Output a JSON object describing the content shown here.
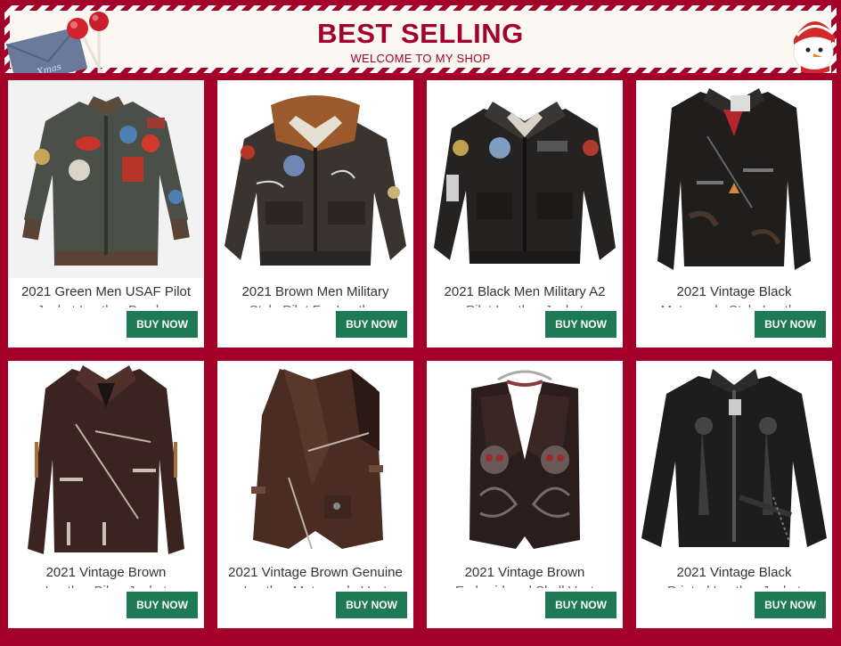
{
  "banner": {
    "title": "BEST SELLING",
    "subtitle": "WELCOME TO MY SHOP",
    "envelope_text": "Xmas",
    "accent_color": "#a3002a",
    "background_color": "#fbf7f1"
  },
  "button_color": "#1d7a55",
  "products": [
    {
      "title": "2021 Green Men USAF Pilot",
      "title_line2": "Jacket Leather Bomber",
      "button": "BUY NOW",
      "icon": "green-pilot-jacket-icon"
    },
    {
      "title": "2021 Brown Men Military",
      "title_line2": "Style Pilot Fur Leather",
      "button": "BUY NOW",
      "icon": "brown-military-jacket-icon"
    },
    {
      "title": "2021 Black Men Military A2",
      "title_line2": "Pilot Leather Jacket",
      "button": "BUY NOW",
      "icon": "black-a2-jacket-icon"
    },
    {
      "title": "2021 Vintage Black",
      "title_line2": "Motorcycle Style Leather",
      "button": "BUY NOW",
      "icon": "black-motorcycle-jacket-icon"
    },
    {
      "title": "2021 Vintage Brown",
      "title_line2": "Leather Biker Jacket",
      "button": "BUY NOW",
      "icon": "brown-biker-jacket-icon"
    },
    {
      "title": "2021 Vintage Brown Genuine",
      "title_line2": "Leather Motorcycle Vest",
      "button": "BUY NOW",
      "icon": "brown-leather-vest-icon"
    },
    {
      "title": "2021 Vintage Brown",
      "title_line2": "Embroidered Skull Vest",
      "button": "BUY NOW",
      "icon": "skull-vest-icon"
    },
    {
      "title": "2021 Vintage Black",
      "title_line2": "Printed Leather Jacket",
      "button": "BUY NOW",
      "icon": "black-printed-jacket-icon"
    }
  ]
}
